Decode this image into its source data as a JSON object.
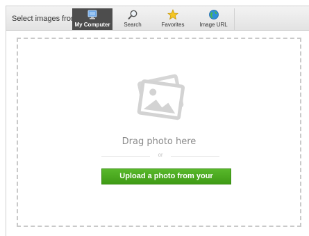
{
  "toolbar": {
    "select_label": "Select images from:",
    "tabs": [
      {
        "label": "My Computer",
        "icon": "monitor-icon",
        "active": true
      },
      {
        "label": "Search",
        "icon": "magnifier-icon",
        "active": false
      },
      {
        "label": "Favorites",
        "icon": "star-icon",
        "active": false
      },
      {
        "label": "Image URL",
        "icon": "globe-icon",
        "active": false
      }
    ]
  },
  "dropzone": {
    "icon": "photo-placeholder-icon",
    "drag_text": "Drag photo here",
    "or_text": "or",
    "upload_label": "Upload a photo from your computer"
  },
  "colors": {
    "active_tab": "#4d4d4d",
    "upload_button": "#4aa81f",
    "dashed_border": "#c9c9c9"
  }
}
